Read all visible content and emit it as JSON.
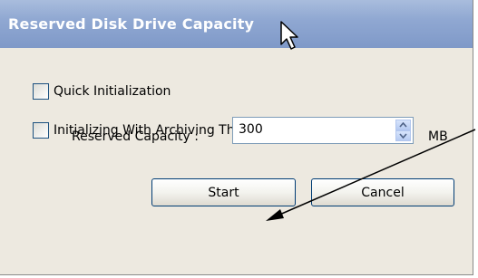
{
  "dialog": {
    "title": "Reserved Disk Drive Capacity"
  },
  "options": {
    "quick_init_label": "Quick Initialization",
    "quick_init_checked": false,
    "archive_init_label": "Initializing With Archiving The Data",
    "archive_init_checked": false
  },
  "capacity": {
    "label": "Reserved Capacity :",
    "value": "300",
    "unit": "MB"
  },
  "buttons": {
    "start_label": "Start",
    "cancel_label": "Cancel"
  },
  "colors": {
    "titlebar": "#90a8d2",
    "dialog_bg": "#ede9e0",
    "annotation_arrow": "#000000"
  },
  "icons": {
    "cursor": "mouse-pointer-icon",
    "spin_up": "spin-up-icon",
    "spin_down": "spin-down-icon"
  }
}
